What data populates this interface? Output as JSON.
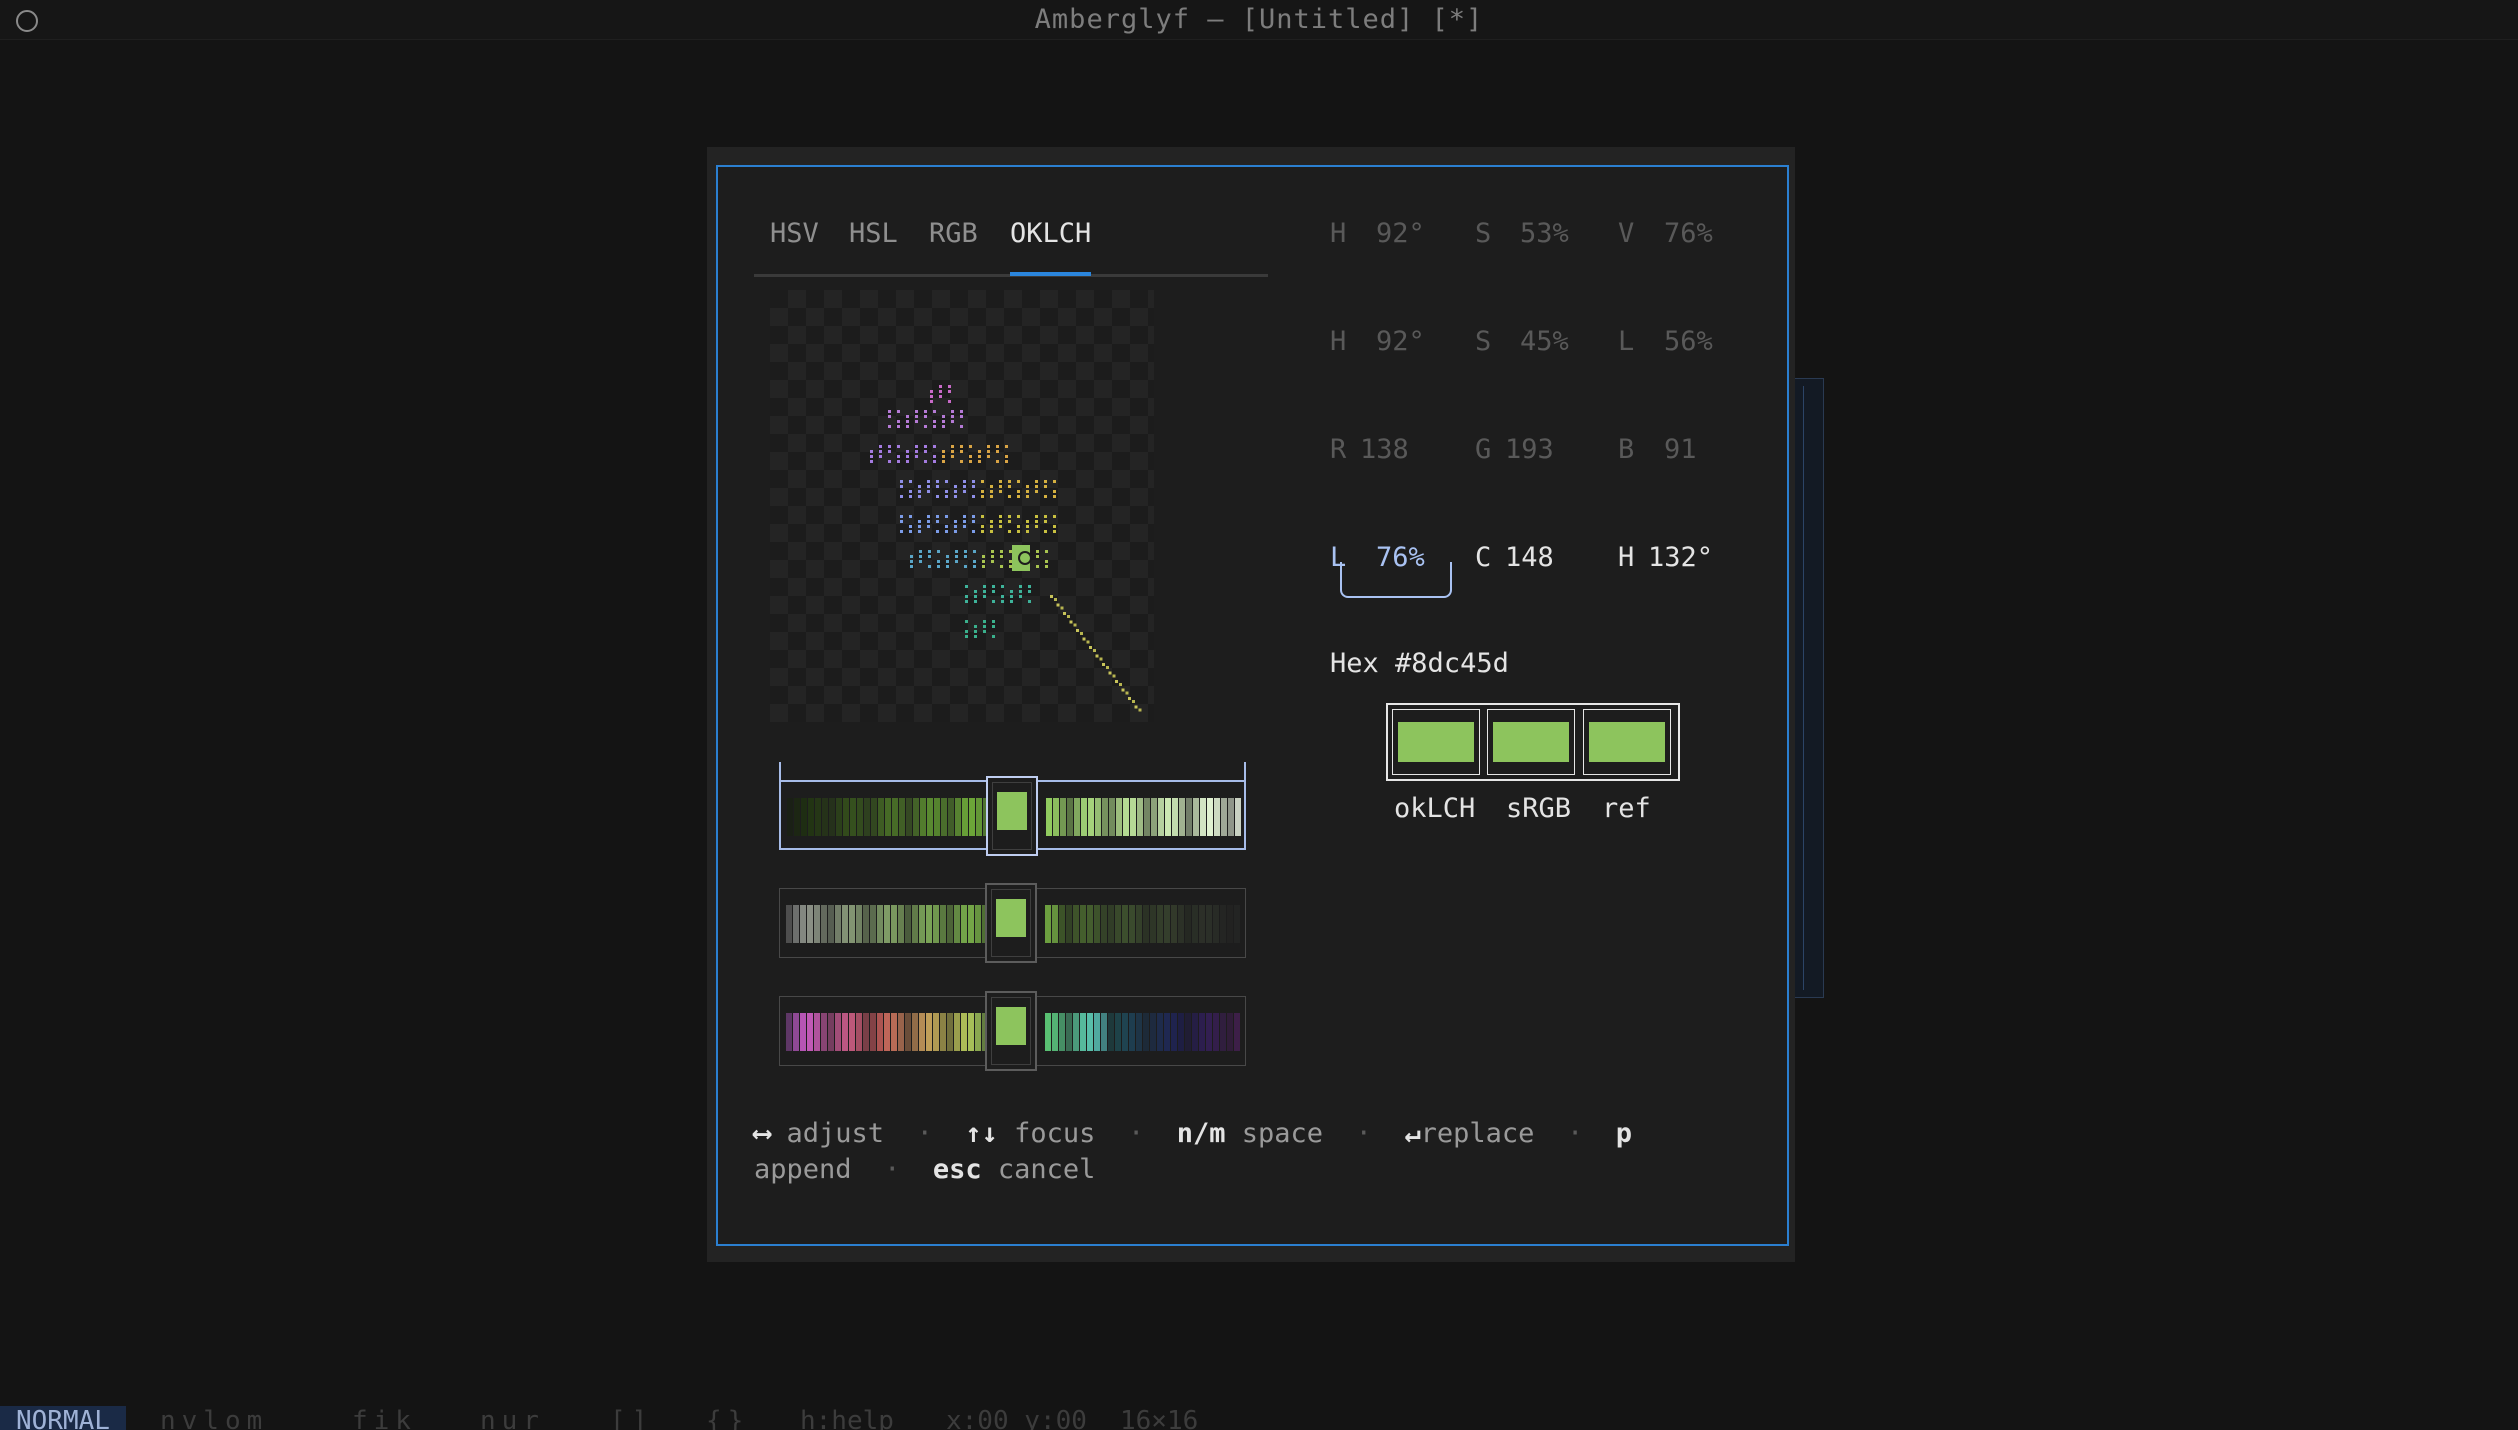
{
  "window": {
    "title": "Amberglyf — [Untitled] [*]"
  },
  "dialog": {
    "tabs": [
      {
        "label": "HSV",
        "active": false
      },
      {
        "label": "HSL",
        "active": false
      },
      {
        "label": "RGB",
        "active": false
      },
      {
        "label": "OKLCH",
        "active": true
      }
    ],
    "rows": {
      "hsv": {
        "a_label": "H",
        "a_value": "92°",
        "b_label": "S",
        "b_value": "53%",
        "c_label": "V",
        "c_value": "76%"
      },
      "hsl": {
        "a_label": "H",
        "a_value": "92°",
        "b_label": "S",
        "b_value": "45%",
        "c_label": "L",
        "c_value": "56%"
      },
      "rgb": {
        "a_label": "R",
        "a_value": "138",
        "b_label": "G",
        "b_value": "193",
        "c_label": "B",
        "c_value": "91"
      },
      "oklch": {
        "a_label": "L",
        "a_value": "76%",
        "b_label": "C",
        "b_value": "148",
        "c_label": "H",
        "c_value": "132°"
      }
    },
    "focused_channel": "L",
    "hex": {
      "label": "Hex",
      "value": "#8dc45d"
    },
    "current_color": "#8dc45d",
    "swatches": [
      {
        "label": "okLCH",
        "color": "#8dc45d"
      },
      {
        "label": "sRGB",
        "color": "#8dc45d"
      },
      {
        "label": "ref",
        "color": "#8dc45d"
      }
    ],
    "help": {
      "adjust_key": "⟷",
      "adjust_label": "adjust",
      "focus_key": "↑↓",
      "focus_label": "focus",
      "space_key": "n/m",
      "space_label": "space",
      "replace_key": "↵",
      "replace_label": "replace",
      "append_key": "p",
      "append_label": "append",
      "cancel_key": "esc",
      "cancel_label": "cancel",
      "separator": "·"
    }
  },
  "statusbar": {
    "mode": "NORMAL",
    "tools_1": "nvlom",
    "tools_2": "fik",
    "tools_3": "nur",
    "brackets_1": "[]",
    "brackets_2": "{}",
    "help": "h:help",
    "coords": "x:00 y:00",
    "size": "16×16"
  }
}
